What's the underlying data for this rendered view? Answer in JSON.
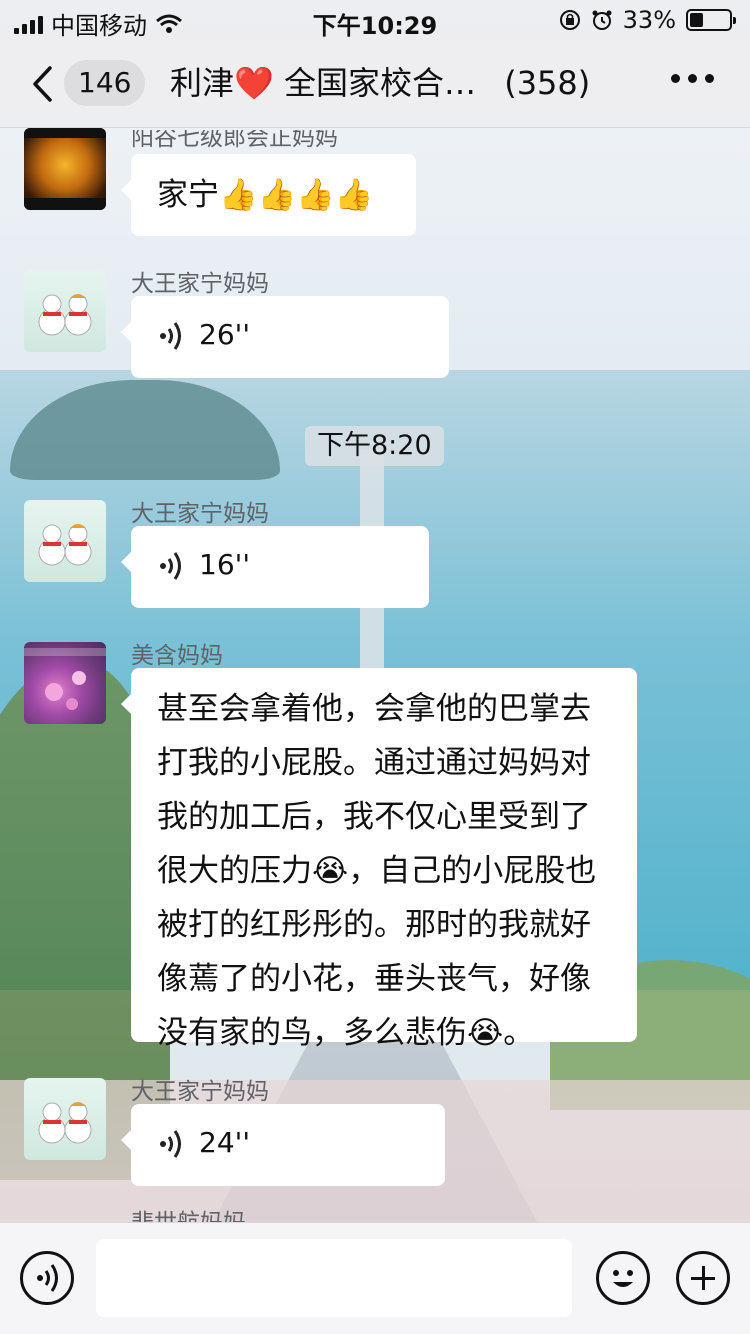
{
  "status_bar": {
    "carrier": "中国移动",
    "time": "下午10:29",
    "battery_percent": "33%",
    "battery_level": 0.33
  },
  "nav": {
    "unread_count": "146",
    "title": "利津❤️ 全国家校合…",
    "member_count": "(358)"
  },
  "messages": [
    {
      "sender": "阳谷七级郎会正妈妈",
      "type": "text",
      "text": "家宁👍👍👍👍",
      "avatar": "golden-heart-avatar"
    },
    {
      "sender": "大王家宁妈妈",
      "type": "voice",
      "duration": "26''",
      "avatar": "snowman-avatar"
    },
    {
      "sender": "大王家宁妈妈",
      "type": "voice",
      "duration": "16''",
      "avatar": "snowman-avatar"
    },
    {
      "sender": "美含妈妈",
      "type": "text",
      "text": "甚至会拿着他，会拿他的巴掌去打我的小屁股。通过通过妈妈对我的加工后，我不仅心里受到了很大的压力😭，自己的小屁股也被打的红彤彤的。那时的我就好像蔫了的小花，垂头丧气，好像没有家的鸟，多么悲伤😭。",
      "avatar": "flower-avatar"
    },
    {
      "sender": "大王家宁妈妈",
      "type": "voice",
      "duration": "24''",
      "avatar": "snowman-avatar"
    }
  ],
  "time_divider": "下午8:20",
  "cut_off_sender": "悲世航妈妈",
  "input_bar": {
    "voice_icon": "voice-input-icon",
    "emoji_icon": "emoji-icon",
    "plus_icon": "plus-icon"
  }
}
